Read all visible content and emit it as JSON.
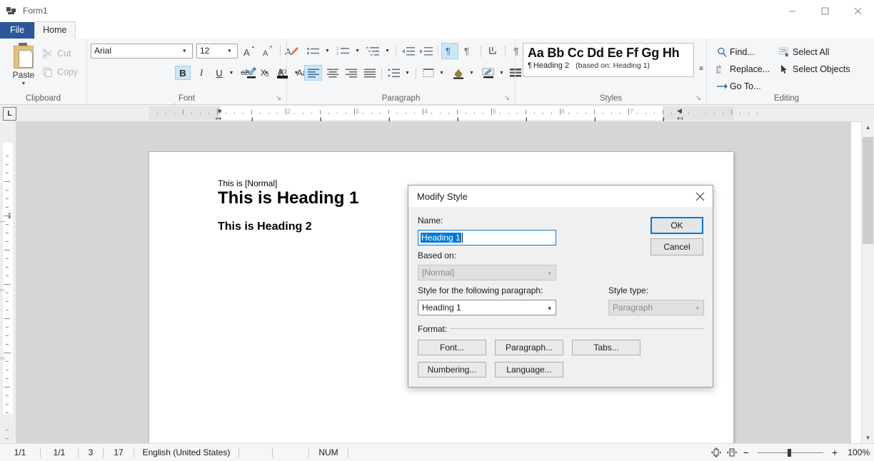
{
  "window": {
    "title": "Form1",
    "icon": "form-icon",
    "controls": {
      "minimize": "—",
      "maximize": "□",
      "close": "✕"
    }
  },
  "ribbon": {
    "tabs": [
      {
        "id": "file",
        "label": "File"
      },
      {
        "id": "home",
        "label": "Home"
      }
    ],
    "active_tab": "Home",
    "groups": {
      "clipboard": {
        "label": "Clipboard",
        "paste_label": "Paste",
        "cut_label": "Cut",
        "copy_label": "Copy"
      },
      "font": {
        "label": "Font",
        "font_name": "Arial",
        "font_size": "12",
        "buttons": {
          "grow": "A",
          "shrink": "A",
          "clear_formatting": "clear-formatting-icon",
          "bold": "B",
          "italic": "I",
          "underline": "U",
          "strikethrough": "abc",
          "subscript": "X₂",
          "superscript": "X²",
          "change_case": "Aa",
          "text_highlight": "highlight-icon",
          "font_color": "A"
        },
        "bold_active": true
      },
      "paragraph": {
        "label": "Paragraph",
        "buttons": [
          "bullets",
          "numbering",
          "multilevel-list",
          "decrease-indent",
          "increase-indent",
          "ltr-text-direction",
          "rtl-text-direction",
          "sort",
          "show-formatting-marks",
          "align-left",
          "align-center",
          "align-right",
          "justify",
          "line-spacing",
          "borders",
          "shading",
          "text-highlight",
          "styles-lines"
        ],
        "align_left_active": true,
        "ltr_active": true
      },
      "styles": {
        "label": "Styles",
        "sample_text": "Aa Bb Cc Dd Ee Ff Gg Hh",
        "style_name": "Heading 2",
        "based_on": "(based on: Heading 1)",
        "pilcrow": "¶"
      },
      "editing": {
        "label": "Editing",
        "items": [
          {
            "label": "Find...",
            "icon": "magnifier-icon"
          },
          {
            "label": "Replace...",
            "icon": "replace-icon"
          },
          {
            "label": "Go To...",
            "icon": "arrow-right-icon"
          },
          {
            "label": "Select All",
            "icon": "select-all-icon"
          },
          {
            "label": "Select Objects",
            "icon": "pointer-icon"
          }
        ]
      }
    }
  },
  "ruler": {
    "tab_selector": "L",
    "numbers": [
      "1",
      "2",
      "3",
      "4",
      "5",
      "6",
      "7"
    ],
    "vertical_numbers": [
      "1",
      "2",
      "3"
    ]
  },
  "document": {
    "lines": [
      {
        "text": "This is [Normal]",
        "style": "normal"
      },
      {
        "text": "This is Heading 1",
        "style": "heading1"
      },
      {
        "text": "This is Heading 2",
        "style": "heading2"
      }
    ]
  },
  "dialog": {
    "title": "Modify Style",
    "close_icon": "close-icon",
    "name_label": "Name:",
    "name_value": "Heading 1",
    "based_on_label": "Based on:",
    "based_on_value": "[Normal]",
    "following_label": "Style for the following paragraph:",
    "following_value": "Heading 1",
    "style_type_label": "Style type:",
    "style_type_value": "Paragraph",
    "format_label": "Format:",
    "buttons": {
      "ok": "OK",
      "cancel": "Cancel",
      "font": "Font...",
      "paragraph": "Paragraph...",
      "tabs": "Tabs...",
      "numbering": "Numbering...",
      "language": "Language..."
    }
  },
  "statusbar": {
    "page": "1/1",
    "section": "1/1",
    "line": "3",
    "column": "17",
    "language": "English (United States)",
    "num_lock": "NUM",
    "zoom_out": "−",
    "zoom_in": "+",
    "zoom_level": "100%",
    "view_icons": [
      "fit-page-icon",
      "fit-width-icon"
    ]
  },
  "colors": {
    "accent": "#2b579a",
    "selection": "#0078d7",
    "ribbon_bg": "#f5f6f7",
    "canvas_bg": "#d6d6d6",
    "highlight": "#cde6f7"
  }
}
